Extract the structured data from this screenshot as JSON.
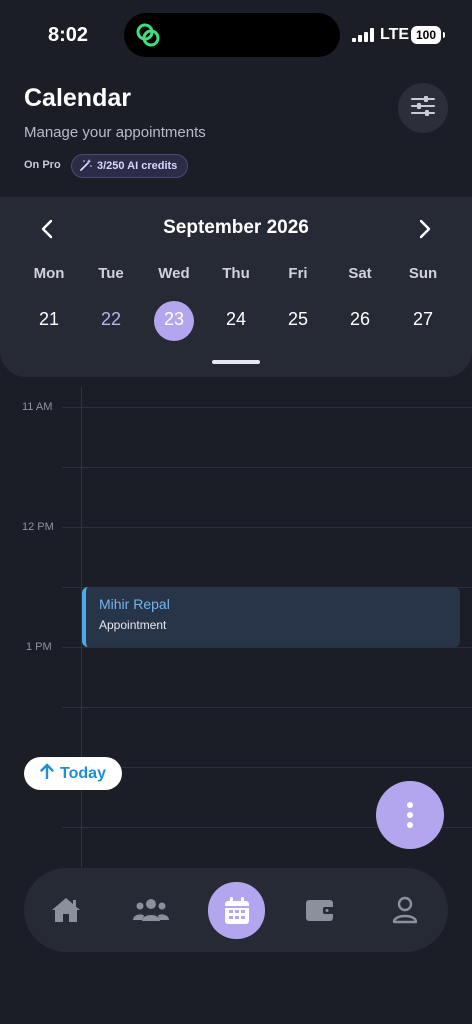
{
  "status_bar": {
    "time": "8:02",
    "network": "LTE",
    "battery": "100"
  },
  "header": {
    "title": "Calendar",
    "subtitle": "Manage your appointments",
    "plan_label": "On Pro",
    "credits_label": "3/250 AI credits",
    "filter_icon": "sliders-icon"
  },
  "calendar": {
    "month_title": "September 2026",
    "prev_icon": "chevron-left-icon",
    "next_icon": "chevron-right-icon",
    "weekdays": [
      "Mon",
      "Tue",
      "Wed",
      "Thu",
      "Fri",
      "Sat",
      "Sun"
    ],
    "days": [
      "21",
      "22",
      "23",
      "24",
      "25",
      "26",
      "27"
    ],
    "selected_day": "23"
  },
  "timeline": {
    "labels": [
      "11 AM",
      "12 PM",
      "1 PM"
    ],
    "event": {
      "name": "Mihir Repal",
      "type": "Appointment"
    }
  },
  "today_button": {
    "label": "Today",
    "icon": "arrow-up-icon"
  },
  "fab": {
    "icon": "more-vertical-icon"
  },
  "bottom_nav": {
    "items": [
      "home-icon",
      "users-icon",
      "calendar-icon",
      "wallet-icon",
      "profile-icon"
    ],
    "active": "calendar-icon"
  },
  "colors": {
    "background": "#1b1e27",
    "card": "#262a35",
    "accent": "#b3a6ef",
    "event_bg": "#283447",
    "event_border": "#4fa8e8",
    "today_text": "#1e8fd2",
    "logo_green": "#3ee07a"
  }
}
